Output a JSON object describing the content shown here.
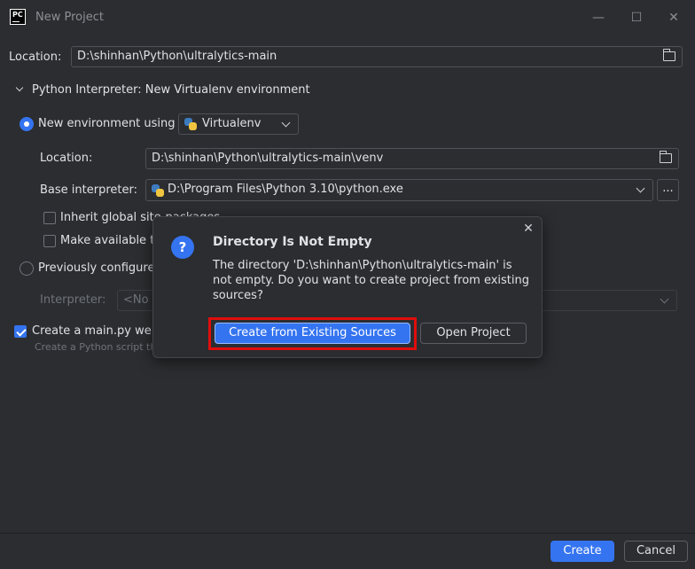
{
  "window": {
    "title": "New Project",
    "logo_text": "PC",
    "minimize": "—",
    "maximize": "☐",
    "close": "✕"
  },
  "project": {
    "location_label": "Location:",
    "location_value": "D:\\shinhan\\Python\\ultralytics-main"
  },
  "interpreter_section": {
    "header": "Python Interpreter: New Virtualenv environment",
    "new_env_label": "New environment using",
    "env_tool": "Virtualenv",
    "env_location_label": "Location:",
    "env_location_value": "D:\\shinhan\\Python\\ultralytics-main\\venv",
    "base_interpreter_label": "Base interpreter:",
    "base_interpreter_value": "D:\\Program Files\\Python 3.10\\python.exe",
    "browse_label": "...",
    "inherit_label": "Inherit global site-packages",
    "make_available_label": "Make available to",
    "previously_configured_label": "Previously configure",
    "interpreter_label": "Interpreter:",
    "interpreter_value": "<No"
  },
  "main_py": {
    "label": "Create a main.py welc",
    "hint": "Create a Python script tha"
  },
  "footer": {
    "create": "Create",
    "cancel": "Cancel"
  },
  "modal": {
    "title": "Directory Is Not Empty",
    "message": "The directory 'D:\\shinhan\\Python\\ultralytics-main' is not empty. Do you want to create project from existing sources?",
    "primary_button": "Create from Existing Sources",
    "secondary_button": "Open Project",
    "close": "✕",
    "icon": "?"
  },
  "colors": {
    "background": "#2b2d30",
    "accent": "#3574f0",
    "highlight": "#e00d0d",
    "text": "#dfe1e5",
    "muted": "#6f737a"
  }
}
